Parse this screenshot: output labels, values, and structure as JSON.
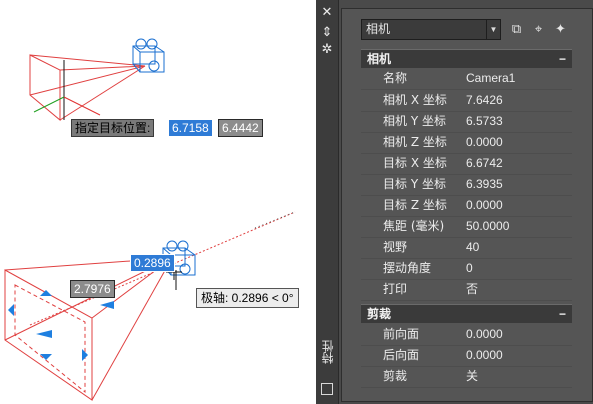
{
  "canvas": {
    "target_prompt": "指定目标位置:",
    "target_x": "6.7158",
    "target_y": "6.4442",
    "input_value": "0.2896",
    "distance_value": "2.7976",
    "polar_tooltip": "极轴: 0.2896 < 0°"
  },
  "palette": {
    "title": "特性",
    "combo_value": "相机",
    "sections": [
      {
        "title": "相机",
        "toggle": "−",
        "rows": [
          {
            "key": "名称",
            "value": "Camera1"
          },
          {
            "key": "相机 X 坐标",
            "value": "7.6426"
          },
          {
            "key": "相机 Y 坐标",
            "value": "6.5733"
          },
          {
            "key": "相机 Z 坐标",
            "value": "0.0000"
          },
          {
            "key": "目标 X 坐标",
            "value": "6.6742"
          },
          {
            "key": "目标 Y 坐标",
            "value": "6.3935"
          },
          {
            "key": "目标 Z 坐标",
            "value": "0.0000"
          },
          {
            "key": "焦距 (毫米)",
            "value": "50.0000"
          },
          {
            "key": "视野",
            "value": "40"
          },
          {
            "key": "摆动角度",
            "value": "0"
          },
          {
            "key": "打印",
            "value": "否"
          }
        ]
      },
      {
        "title": "剪裁",
        "toggle": "−",
        "rows": [
          {
            "key": "前向面",
            "value": "0.0000"
          },
          {
            "key": "后向面",
            "value": "0.0000"
          },
          {
            "key": "剪裁",
            "value": "关"
          }
        ]
      }
    ]
  },
  "colors": {
    "frustum": "#e04040",
    "camera": "#1a6fd0",
    "grip": "#1e7fe0",
    "axis_x": "#e03030",
    "axis_y": "#20a020"
  }
}
